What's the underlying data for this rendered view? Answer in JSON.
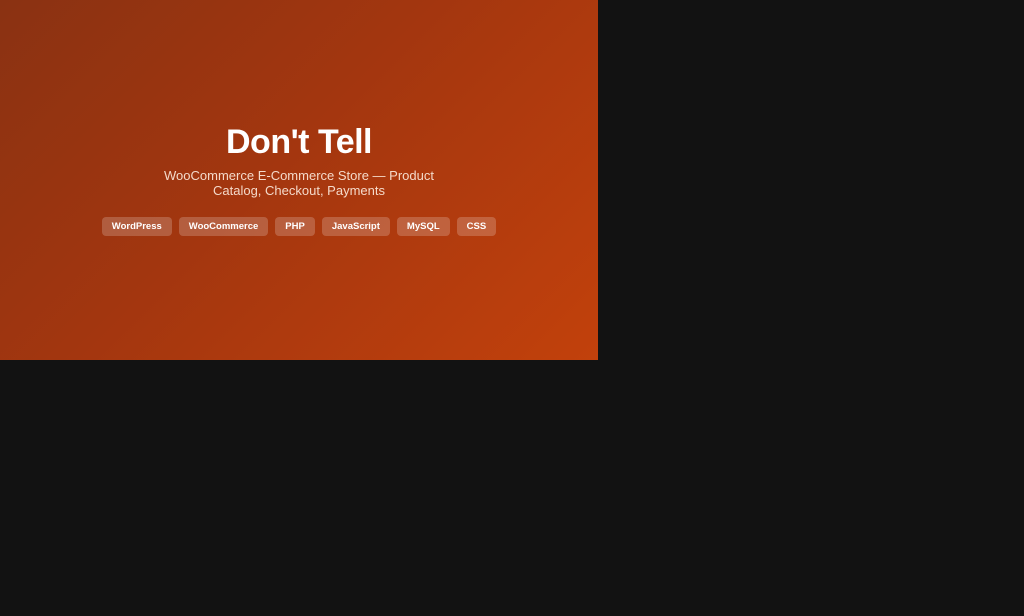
{
  "hero": {
    "title": "Don't Tell",
    "subtitle": "WooCommerce E-Commerce Store — Product Catalog, Checkout, Payments",
    "tags": [
      "WordPress",
      "WooCommerce",
      "PHP",
      "JavaScript",
      "MySQL",
      "CSS"
    ]
  },
  "colors": {
    "page_background": "#121212",
    "hero_gradient_start": "#8a3212",
    "hero_gradient_end": "#c2410c",
    "text": "#ffffff"
  }
}
